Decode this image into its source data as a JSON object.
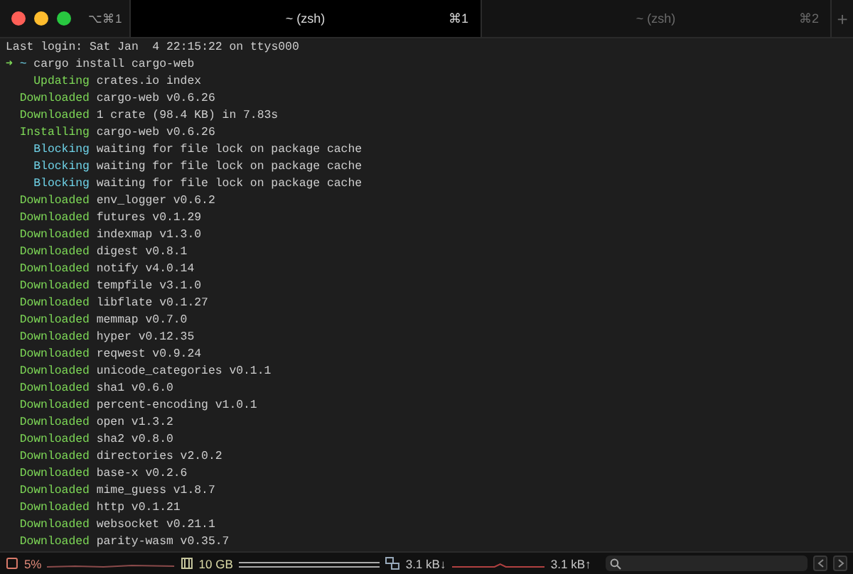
{
  "tab_bar": {
    "window_shortcut": "⌥⌘1",
    "tabs": [
      {
        "title": "~ (zsh)",
        "shortcut": "⌘1",
        "selected": true
      },
      {
        "title": "~ (zsh)",
        "shortcut": "⌘2",
        "selected": false
      }
    ],
    "new_tab": "+"
  },
  "terminal": {
    "lines": [
      {
        "kind": "plain",
        "text": "Last login: Sat Jan  4 22:15:22 on ttys000"
      },
      {
        "kind": "prompt",
        "arrow": "➜",
        "cwd": "~",
        "text": "cargo install cargo-web"
      },
      {
        "kind": "status",
        "status": "Updating",
        "color": "#7ed957",
        "text": "crates.io index"
      },
      {
        "kind": "status",
        "status": "Downloaded",
        "color": "#7ed957",
        "text": "cargo-web v0.6.26"
      },
      {
        "kind": "status",
        "status": "Downloaded",
        "color": "#7ed957",
        "text": "1 crate (98.4 KB) in 7.83s"
      },
      {
        "kind": "status",
        "status": "Installing",
        "color": "#7ed957",
        "text": "cargo-web v0.6.26"
      },
      {
        "kind": "status",
        "status": "Blocking",
        "color": "#6fd3e8",
        "text": "waiting for file lock on package cache"
      },
      {
        "kind": "status",
        "status": "Blocking",
        "color": "#6fd3e8",
        "text": "waiting for file lock on package cache"
      },
      {
        "kind": "status",
        "status": "Blocking",
        "color": "#6fd3e8",
        "text": "waiting for file lock on package cache"
      },
      {
        "kind": "status",
        "status": "Downloaded",
        "color": "#7ed957",
        "text": "env_logger v0.6.2"
      },
      {
        "kind": "status",
        "status": "Downloaded",
        "color": "#7ed957",
        "text": "futures v0.1.29"
      },
      {
        "kind": "status",
        "status": "Downloaded",
        "color": "#7ed957",
        "text": "indexmap v1.3.0"
      },
      {
        "kind": "status",
        "status": "Downloaded",
        "color": "#7ed957",
        "text": "digest v0.8.1"
      },
      {
        "kind": "status",
        "status": "Downloaded",
        "color": "#7ed957",
        "text": "notify v4.0.14"
      },
      {
        "kind": "status",
        "status": "Downloaded",
        "color": "#7ed957",
        "text": "tempfile v3.1.0"
      },
      {
        "kind": "status",
        "status": "Downloaded",
        "color": "#7ed957",
        "text": "libflate v0.1.27"
      },
      {
        "kind": "status",
        "status": "Downloaded",
        "color": "#7ed957",
        "text": "memmap v0.7.0"
      },
      {
        "kind": "status",
        "status": "Downloaded",
        "color": "#7ed957",
        "text": "hyper v0.12.35"
      },
      {
        "kind": "status",
        "status": "Downloaded",
        "color": "#7ed957",
        "text": "reqwest v0.9.24"
      },
      {
        "kind": "status",
        "status": "Downloaded",
        "color": "#7ed957",
        "text": "unicode_categories v0.1.1"
      },
      {
        "kind": "status",
        "status": "Downloaded",
        "color": "#7ed957",
        "text": "sha1 v0.6.0"
      },
      {
        "kind": "status",
        "status": "Downloaded",
        "color": "#7ed957",
        "text": "percent-encoding v1.0.1"
      },
      {
        "kind": "status",
        "status": "Downloaded",
        "color": "#7ed957",
        "text": "open v1.3.2"
      },
      {
        "kind": "status",
        "status": "Downloaded",
        "color": "#7ed957",
        "text": "sha2 v0.8.0"
      },
      {
        "kind": "status",
        "status": "Downloaded",
        "color": "#7ed957",
        "text": "directories v2.0.2"
      },
      {
        "kind": "status",
        "status": "Downloaded",
        "color": "#7ed957",
        "text": "base-x v0.2.6"
      },
      {
        "kind": "status",
        "status": "Downloaded",
        "color": "#7ed957",
        "text": "mime_guess v1.8.7"
      },
      {
        "kind": "status",
        "status": "Downloaded",
        "color": "#7ed957",
        "text": "http v0.1.21"
      },
      {
        "kind": "status",
        "status": "Downloaded",
        "color": "#7ed957",
        "text": "websocket v0.21.1"
      },
      {
        "kind": "status",
        "status": "Downloaded",
        "color": "#7ed957",
        "text": "parity-wasm v0.35.7"
      }
    ]
  },
  "status_bar": {
    "cpu": "5%",
    "memory": "10 GB",
    "download": "3.1 kB↓",
    "upload": "3.1 kB↑"
  }
}
